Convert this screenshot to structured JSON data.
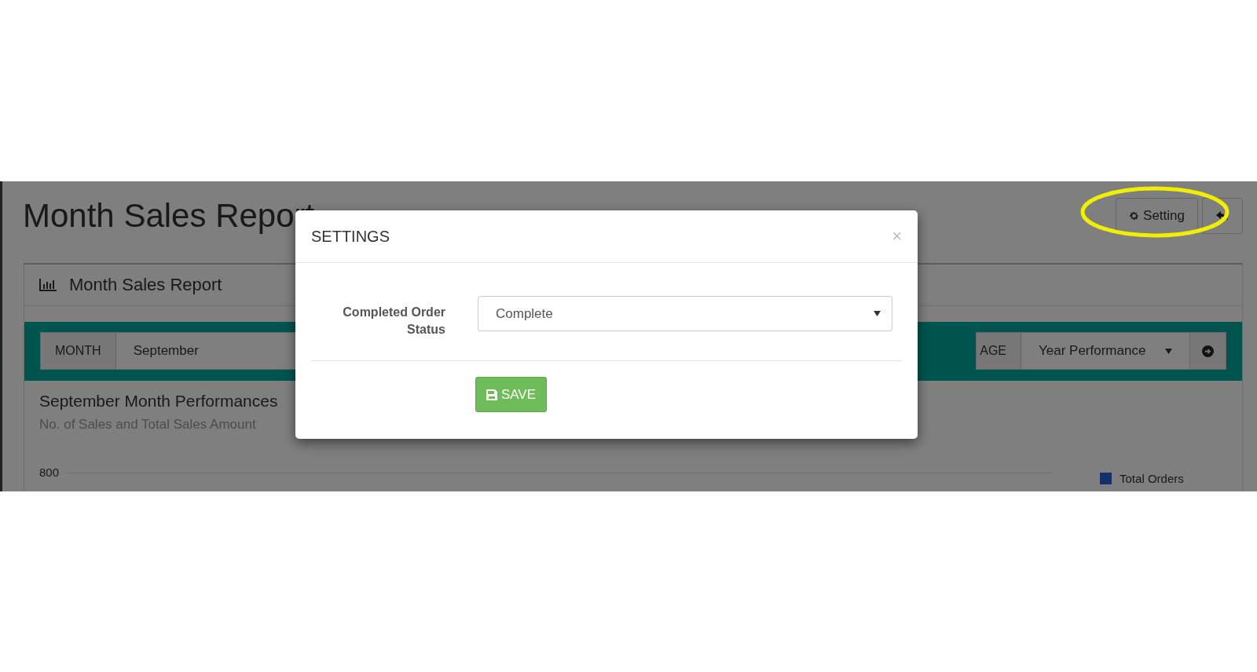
{
  "page": {
    "title": "Month Sales Report",
    "setting_button": "Setting"
  },
  "panel": {
    "title": "Month Sales Report",
    "filters": {
      "month_label": "MONTH",
      "month_value": "September",
      "range_label": "AGE",
      "range_value": "Year Performance"
    },
    "chart": {
      "title": "September Month Performances",
      "subtitle": "No. of Sales and Total Sales Amount",
      "y_tick": "800",
      "legend": [
        "Total Orders"
      ]
    }
  },
  "modal": {
    "title": "SETTINGS",
    "close": "×",
    "fields": [
      {
        "label": "Completed Order Status",
        "value": "Complete"
      }
    ],
    "save_button": "SAVE"
  }
}
